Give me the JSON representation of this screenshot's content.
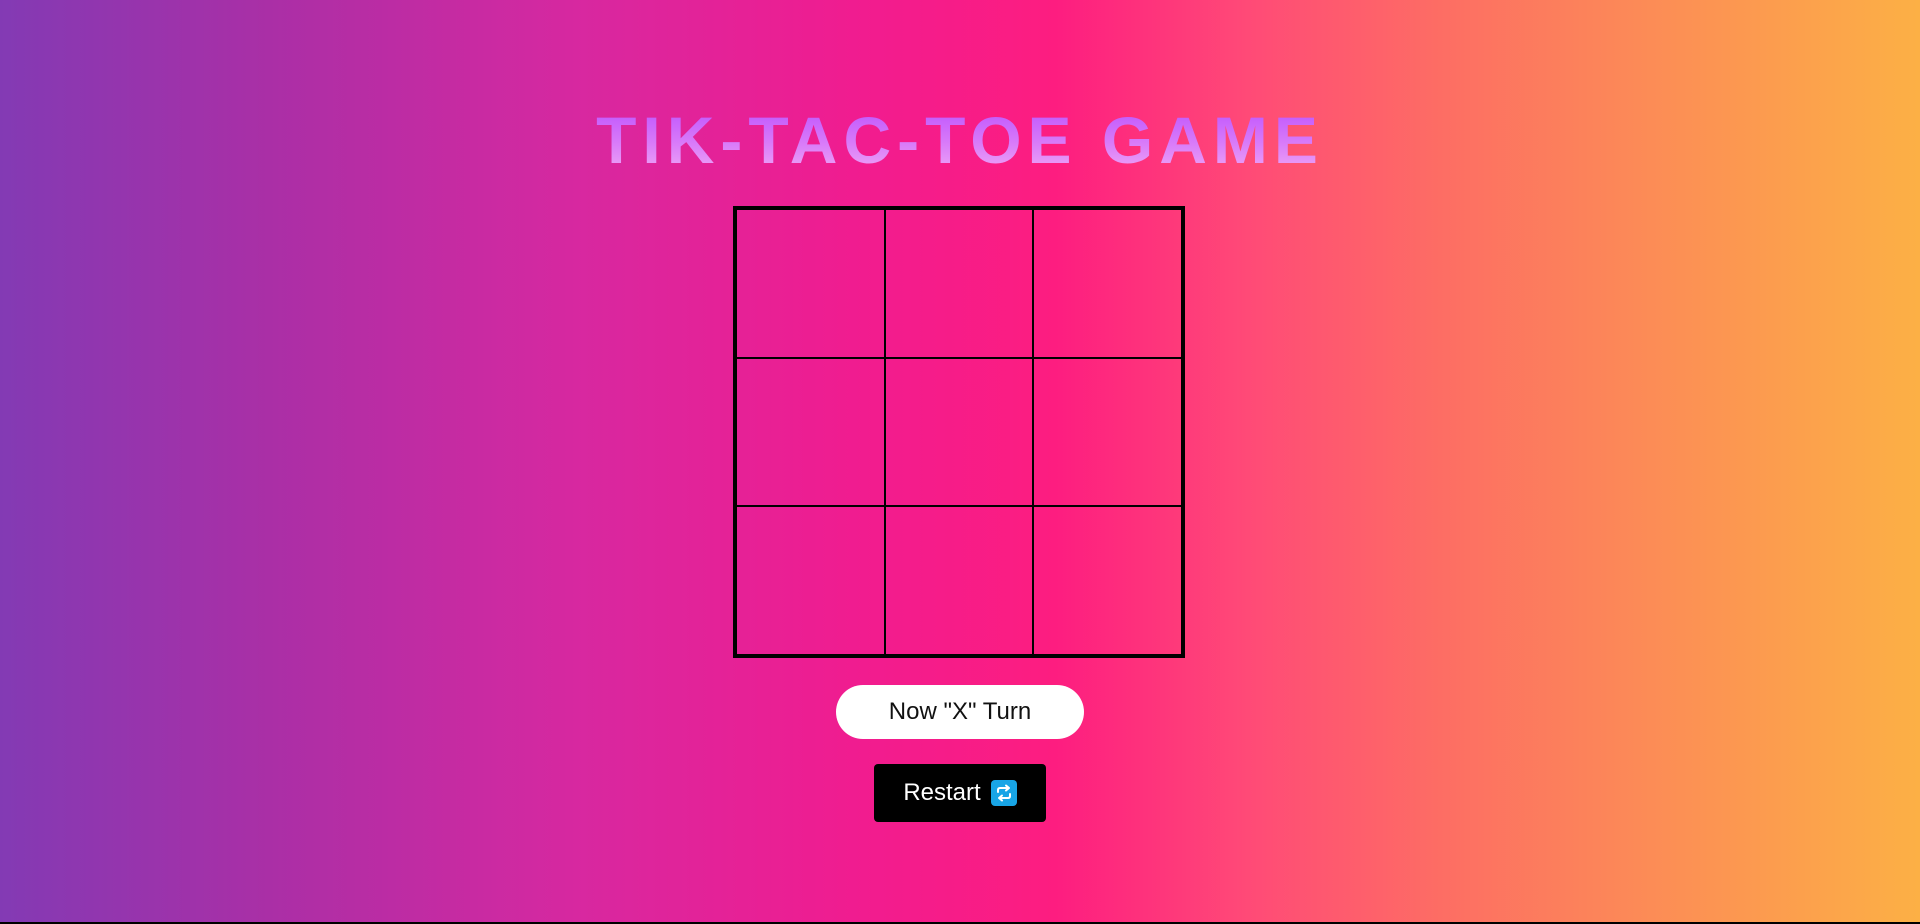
{
  "game": {
    "title": "TIK-TAC-TOE GAME",
    "board": {
      "cells": [
        "",
        "",
        "",
        "",
        "",
        "",
        "",
        "",
        ""
      ]
    },
    "status": "Now \"X\" Turn",
    "restart_label": "Restart",
    "restart_icon": "repeat-icon"
  },
  "colors": {
    "background_gradient": [
      "#833ab4",
      "#fd1d80",
      "#fcb045"
    ],
    "title_gradient": [
      "#b94cff",
      "#f4b0f5"
    ],
    "grid_lines": "#000000",
    "status_bg": "#ffffff",
    "button_bg": "#000000",
    "icon_bg": "#18a5e6"
  }
}
